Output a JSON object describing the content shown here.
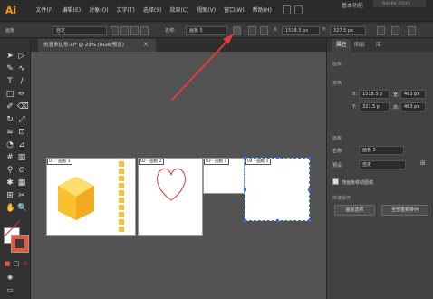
{
  "app": {
    "logo": "Ai",
    "workspace": "基本功能",
    "search_placeholder": "Adobe Stock"
  },
  "menubar": {
    "items": [
      "文件(F)",
      "编辑(E)",
      "对象(O)",
      "文字(T)",
      "选择(S)",
      "效果(C)",
      "视图(V)",
      "窗口(W)",
      "帮助(H)"
    ]
  },
  "control_bar": {
    "label_artboard": "画板",
    "preset_value": "自定",
    "name_label": "名称:",
    "name_value": "画板 5",
    "x_label": "X:",
    "x_value": "1518.5 px",
    "y_label": "Y:",
    "y_value": "327.5 px"
  },
  "document_tab": {
    "title": "创意多边形.ai* @ 29% (RGB/预览)"
  },
  "artboards": [
    {
      "label": "01 - 画板 1"
    },
    {
      "label": "02 - 画板 2"
    },
    {
      "label": "03 - 画板 4"
    },
    {
      "label": "04 - 画板 5"
    }
  ],
  "right_panel": {
    "tabs": [
      "属性",
      "图层",
      "库"
    ],
    "section_artboard": "画板",
    "section_transform": "变换",
    "x_label": "X:",
    "x_value": "1518.5 p",
    "w_label": "宽:",
    "w_value": "463 px",
    "y_label": "Y:",
    "y_value": "327.5 p",
    "h_label": "高:",
    "h_value": "463 px",
    "section_artboard2": "画板",
    "name_label": "名称:",
    "name_value": "画板 5",
    "preset_label": "预设:",
    "preset_value": "自定",
    "checkbox_label": "随画板移动图稿",
    "section_quick": "快速操作",
    "btn_artboard_options": "画板选项",
    "btn_rearrange": "全部重新排列"
  },
  "colors": {
    "accent": "#ff9a00",
    "annotation_arrow": "#e23b3b",
    "selection": "#2a6ff5",
    "hexagon": "#f7b820"
  },
  "icons": [
    "select-arrow-icon",
    "direct-select-icon",
    "pen-icon",
    "type-icon",
    "line-icon",
    "rectangle-icon",
    "brush-icon",
    "pencil-icon",
    "eraser-icon",
    "rotate-icon",
    "scale-icon",
    "width-icon",
    "shape-builder-icon",
    "perspective-icon",
    "mesh-icon",
    "gradient-icon",
    "eyedropper-icon",
    "blend-icon",
    "symbol-sprayer-icon",
    "graph-icon",
    "artboard-icon",
    "slice-icon",
    "hand-icon",
    "zoom-icon"
  ]
}
